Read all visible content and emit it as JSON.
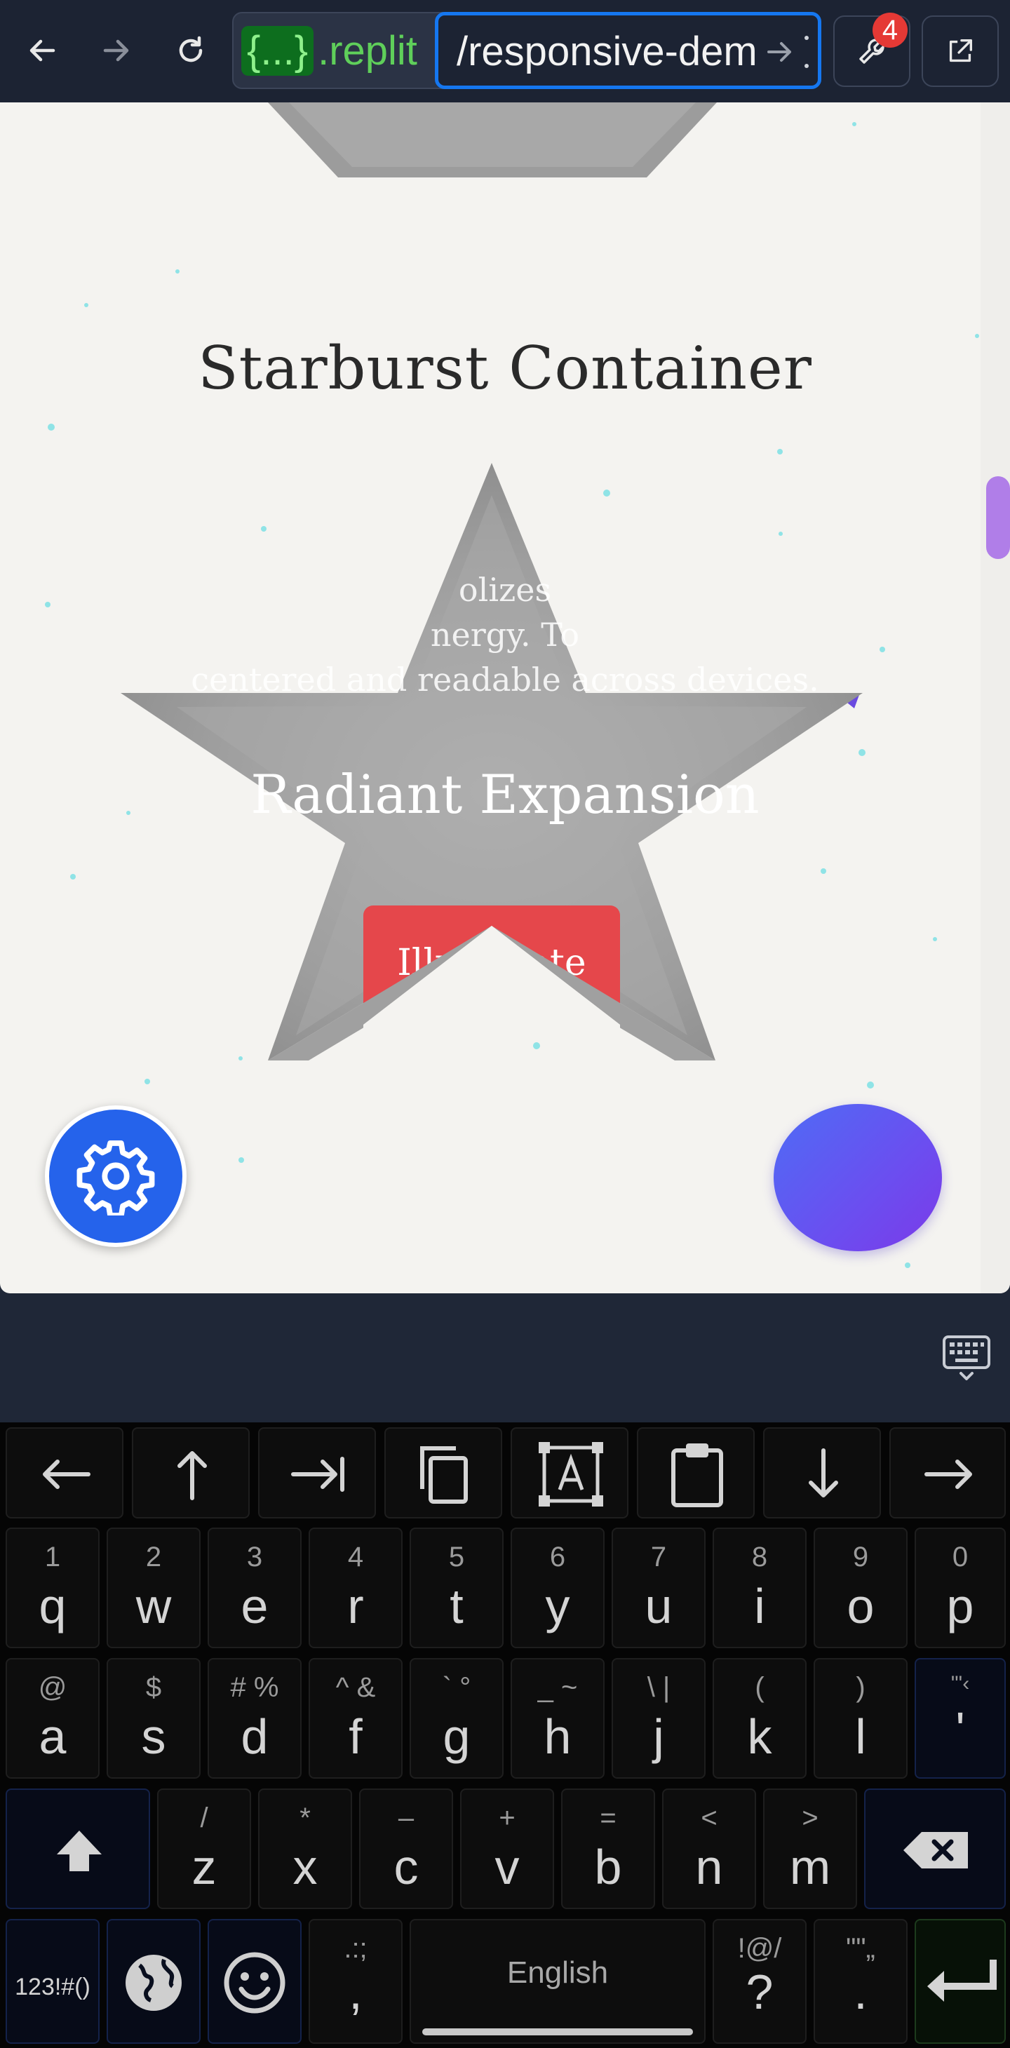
{
  "browser": {
    "url_host_badge": "{...}",
    "url_host": ".replit",
    "url_path": "/responsive-dem",
    "notification_count": "4"
  },
  "page": {
    "section_title": "Starburst Container",
    "paragraph_lines": [
      "olizes",
      "nergy. To",
      "centered and readable across devices."
    ],
    "heading": "Radiant Expansion",
    "cta_label": "Illuminate"
  },
  "keyboard": {
    "row1": [
      {
        "main": "q",
        "hint": "1"
      },
      {
        "main": "w",
        "hint": "2"
      },
      {
        "main": "e",
        "hint": "3"
      },
      {
        "main": "r",
        "hint": "4"
      },
      {
        "main": "t",
        "hint": "5"
      },
      {
        "main": "y",
        "hint": "6"
      },
      {
        "main": "u",
        "hint": "7"
      },
      {
        "main": "i",
        "hint": "8"
      },
      {
        "main": "o",
        "hint": "9"
      },
      {
        "main": "p",
        "hint": "0"
      }
    ],
    "row2": [
      {
        "main": "a",
        "hint": "@"
      },
      {
        "main": "s",
        "hint": "$"
      },
      {
        "main": "d",
        "hint": "# %"
      },
      {
        "main": "f",
        "hint": "^ &"
      },
      {
        "main": "g",
        "hint": "` °"
      },
      {
        "main": "h",
        "hint": "_ ~"
      },
      {
        "main": "j",
        "hint": "\\ |"
      },
      {
        "main": "k",
        "hint": "("
      },
      {
        "main": "l",
        "hint": ")"
      },
      {
        "main": "'",
        "hint": "\"'‹"
      }
    ],
    "row3": [
      {
        "main": "z",
        "hint": "/"
      },
      {
        "main": "x",
        "hint": "*"
      },
      {
        "main": "c",
        "hint": "–"
      },
      {
        "main": "v",
        "hint": "+"
      },
      {
        "main": "b",
        "hint": "="
      },
      {
        "main": "n",
        "hint": "<"
      },
      {
        "main": "m",
        "hint": ">"
      }
    ],
    "symbols_label": "123!#()",
    "comma": {
      "main": ",",
      "hint": ".:;"
    },
    "space_label": "English",
    "question": {
      "main": "?",
      "hint": "!@/"
    },
    "period": {
      "main": ".",
      "hint": "\"\"„"
    }
  }
}
